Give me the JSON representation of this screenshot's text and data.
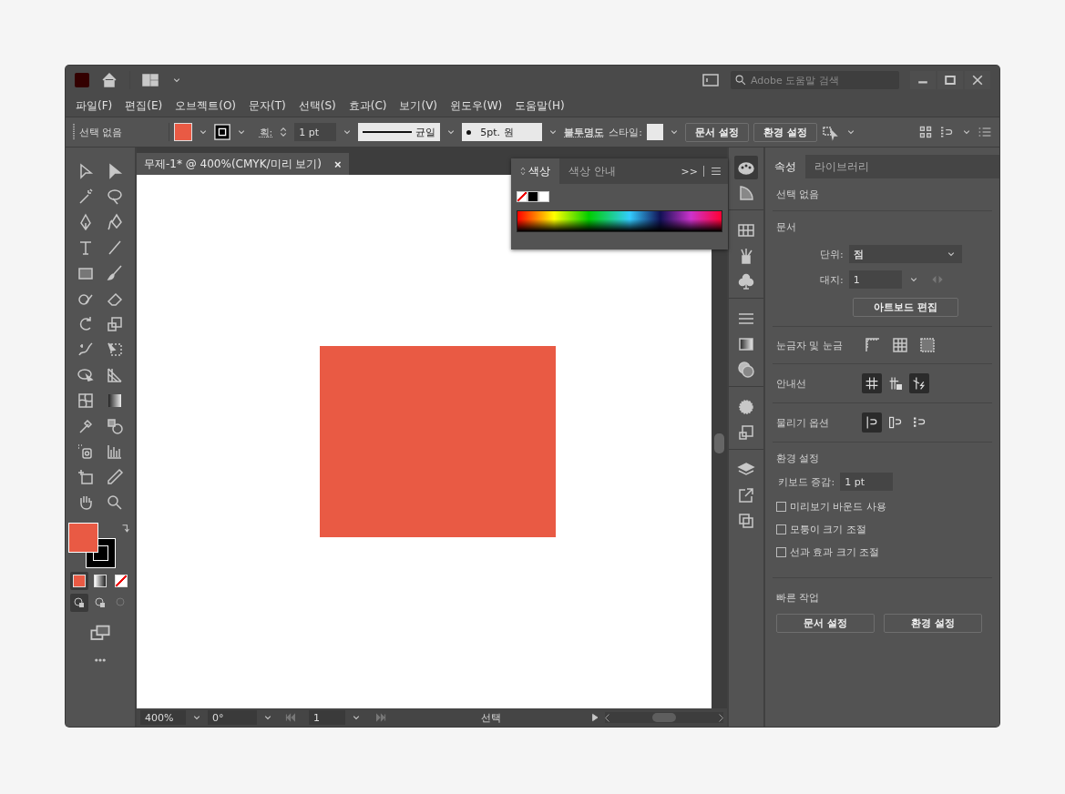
{
  "title_bar": {
    "search": {
      "placeholder": "Adobe 도움말 검색"
    }
  },
  "menu": [
    "파일(F)",
    "편집(E)",
    "오브젝트(O)",
    "문자(T)",
    "선택(S)",
    "효과(C)",
    "보기(V)",
    "윈도우(W)",
    "도움말(H)"
  ],
  "control_bar": {
    "selection": "선택 없음",
    "stroke_label": "획:",
    "stroke_weight": "1 pt",
    "stroke_profile": "균일",
    "brush": "5pt. 원",
    "opacity_label": "불투명도",
    "style_label": "스타일:",
    "buttons": [
      "문서 설정",
      "환경 설정"
    ]
  },
  "tools_panel": {
    "color_modes": [
      {
        "selected": true
      },
      {
        "selected": false
      },
      {
        "selected": false
      }
    ],
    "draw_modes": [
      {
        "selected": true
      },
      {
        "selected": false
      },
      {
        "selected": false
      }
    ]
  },
  "document_tab": {
    "title": "무제-1* @ 400%(CMYK/미리 보기)",
    "close": "×"
  },
  "color_panel": {
    "tabs": [
      {
        "label": "색상",
        "selected": true
      },
      {
        "label": "색상 안내",
        "selected": false
      }
    ],
    "more": ">>"
  },
  "status_bar": {
    "zoom": "400%",
    "rotation": "0°",
    "artboard": "1",
    "tool": "선택"
  },
  "properties": {
    "tabs": [
      {
        "label": "속성",
        "selected": true
      },
      {
        "label": "라이브러리",
        "selected": false
      }
    ],
    "selection": "선택 없음",
    "document": {
      "title": "문서",
      "unit_label": "단위:",
      "unit": "점",
      "artboard_label": "대지:",
      "artboard": "1",
      "edit_button": "아트보드 편집"
    },
    "rulers_label": "눈금자 및 눈금",
    "guides": {
      "label": "안내선",
      "toggles": [
        {
          "selected": true
        },
        {
          "selected": false
        },
        {
          "selected": true
        }
      ]
    },
    "snap": {
      "label": "물리기 옵션",
      "toggles": [
        {
          "selected": true
        },
        {
          "selected": false
        },
        {
          "selected": false
        }
      ]
    },
    "preferences": {
      "title": "환경 설정",
      "keyboard_label": "키보드 증감:",
      "keyboard": "1 pt",
      "options": [
        {
          "label": "미리보기 바운드 사용",
          "checked": false
        },
        {
          "label": "모퉁이 크기 조절",
          "checked": false
        },
        {
          "label": "선과 효과 크기 조절",
          "checked": false
        }
      ]
    },
    "quick_actions": {
      "title": "빠른 작업",
      "buttons": [
        "문서 설정",
        "환경 설정"
      ]
    }
  }
}
